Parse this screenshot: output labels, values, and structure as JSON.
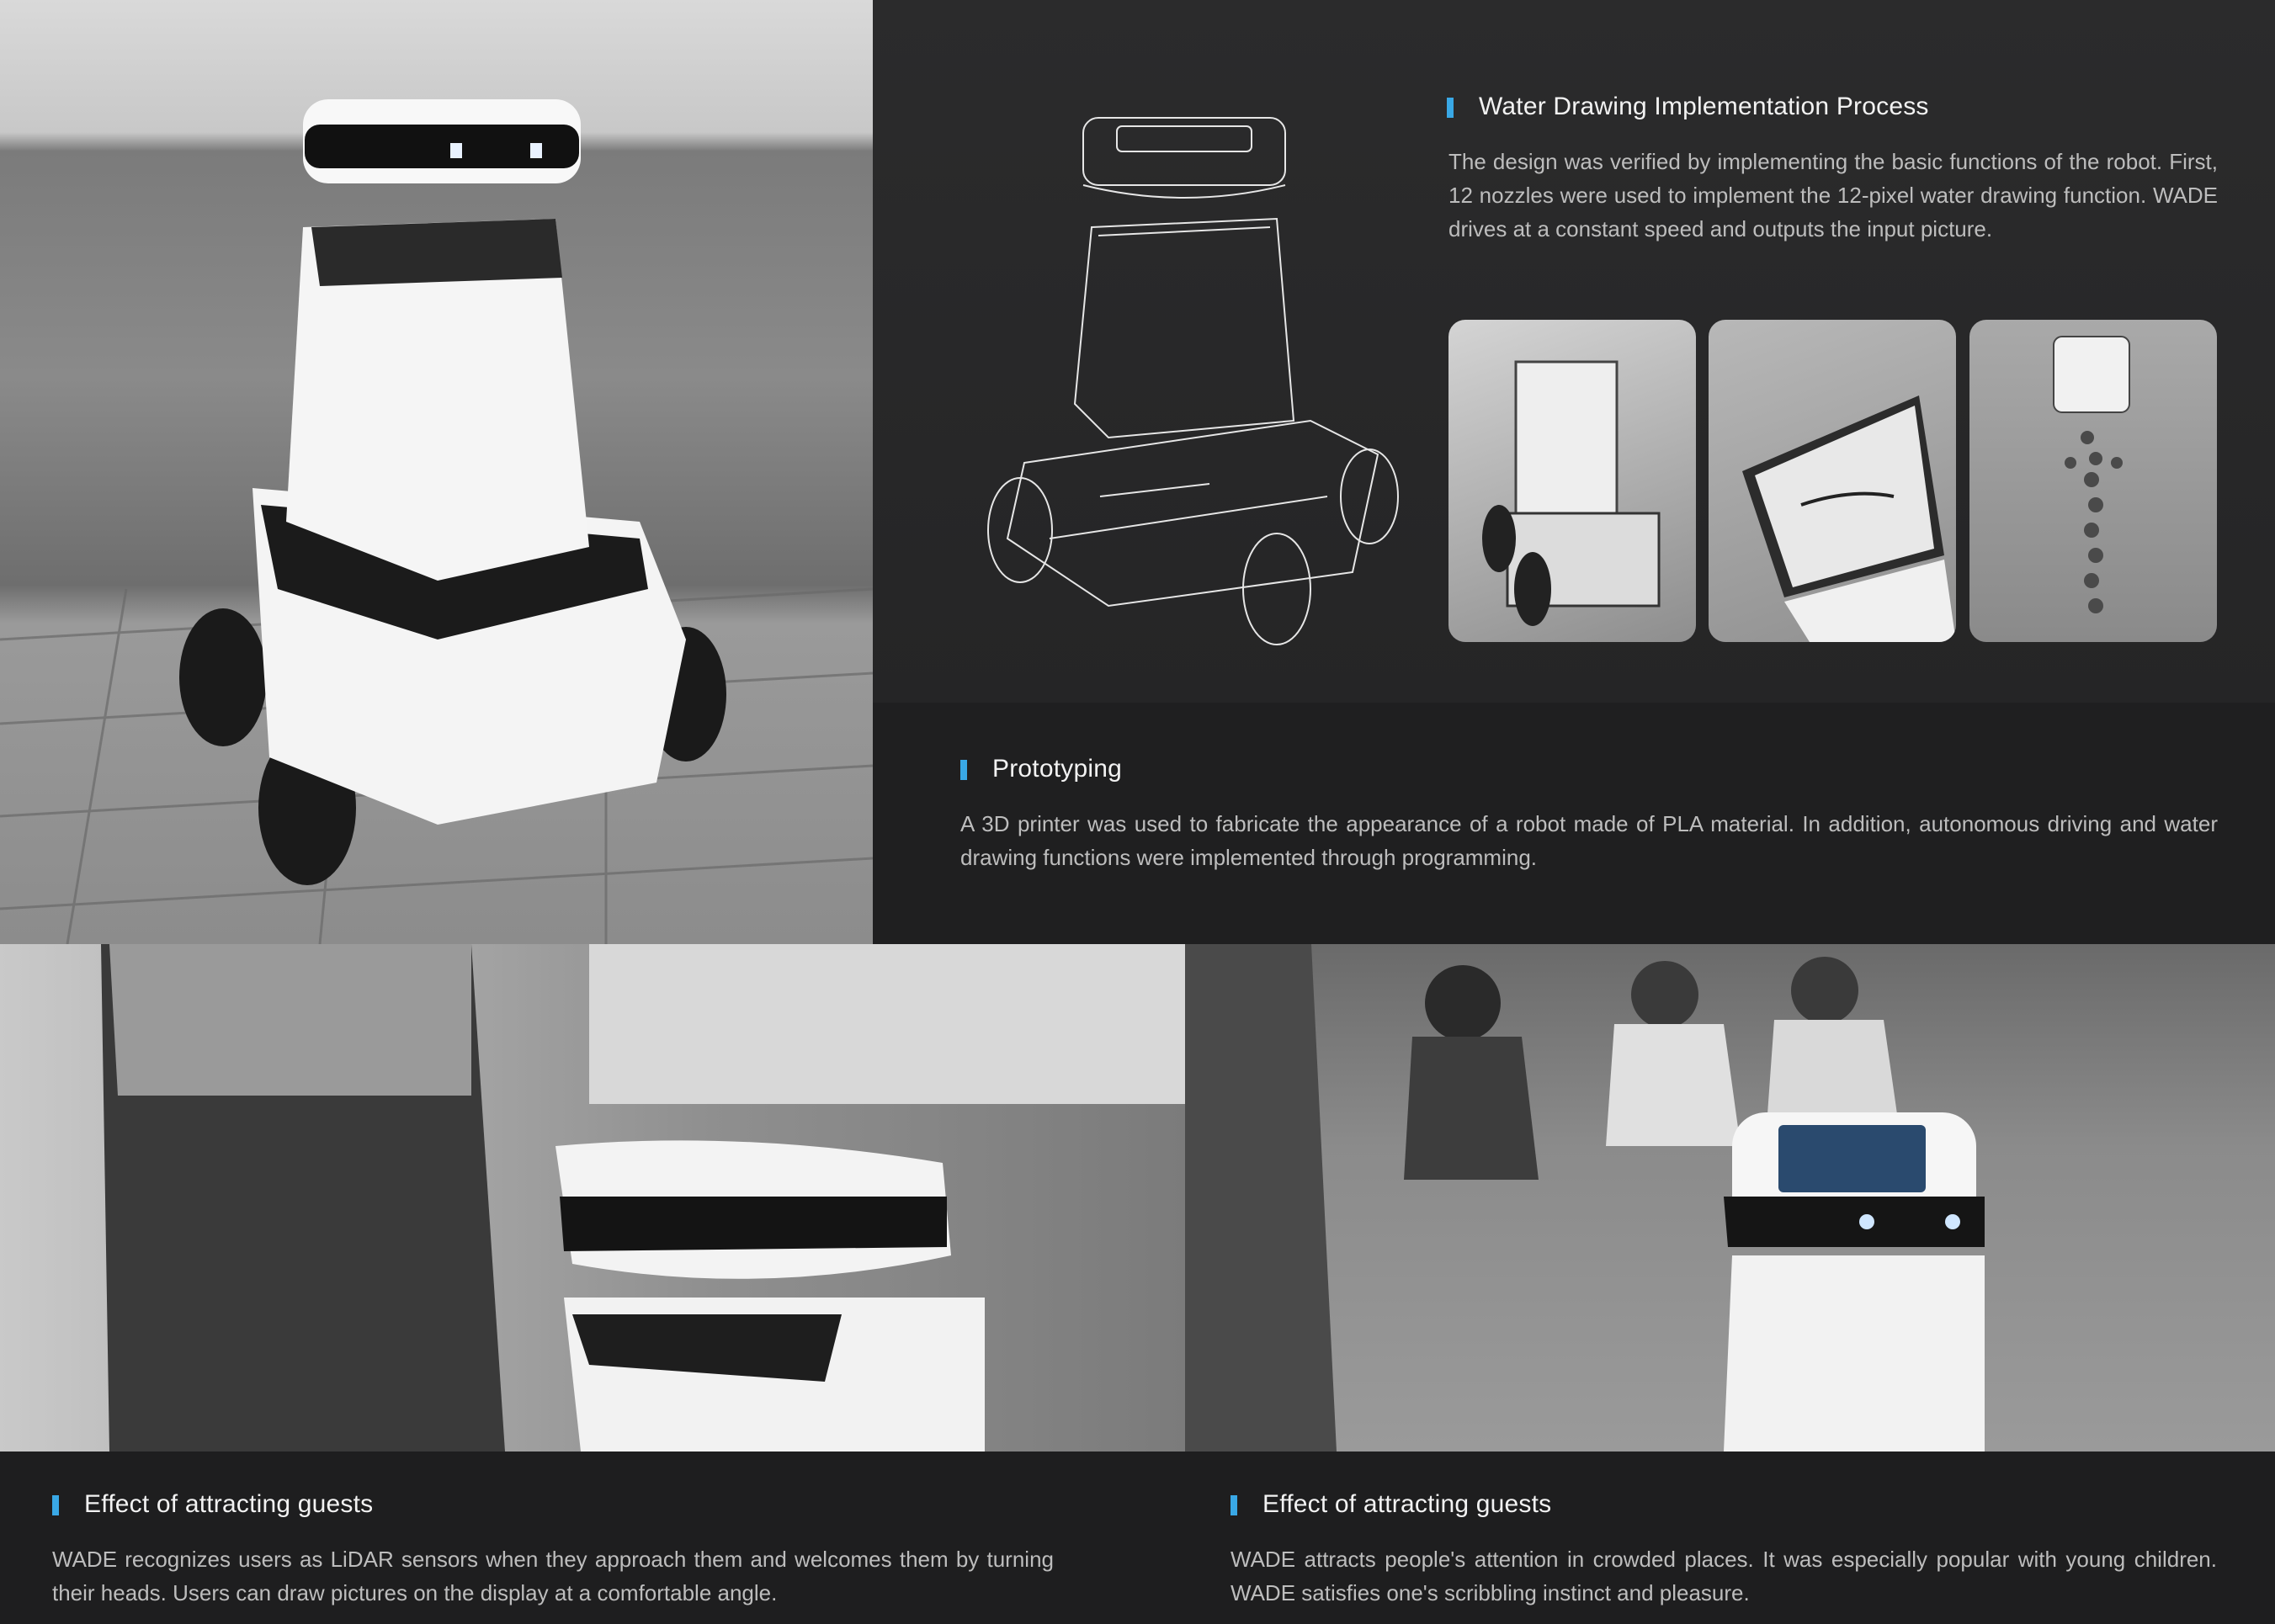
{
  "sections": {
    "water_drawing": {
      "heading": "Water Drawing Implementation Process",
      "body": "The design was verified by implementing the basic functions of the robot. First, 12 nozzles were used to implement the 12-pixel water drawing function. WADE drives at a constant speed and outputs the input picture."
    },
    "prototyping": {
      "heading": "Prototyping",
      "body": "A 3D printer was used to fabricate the appearance of a robot made of PLA material. In addition, autonomous driving and water drawing functions were implemented through programming."
    },
    "effect_left": {
      "heading": "Effect of attracting guests",
      "body": "WADE recognizes users as LiDAR sensors when they approach them and welcomes them by turning their heads. Users can draw pictures on the display at a comfortable angle."
    },
    "effect_right": {
      "heading": "Effect of attracting guests",
      "body": "WADE attracts people's attention in crowded places. It was especially popular with young children. WADE satisfies one's scribbling instinct and pleasure."
    }
  },
  "colors": {
    "accent": "#39a8e6",
    "background": "#1e1e1f"
  }
}
